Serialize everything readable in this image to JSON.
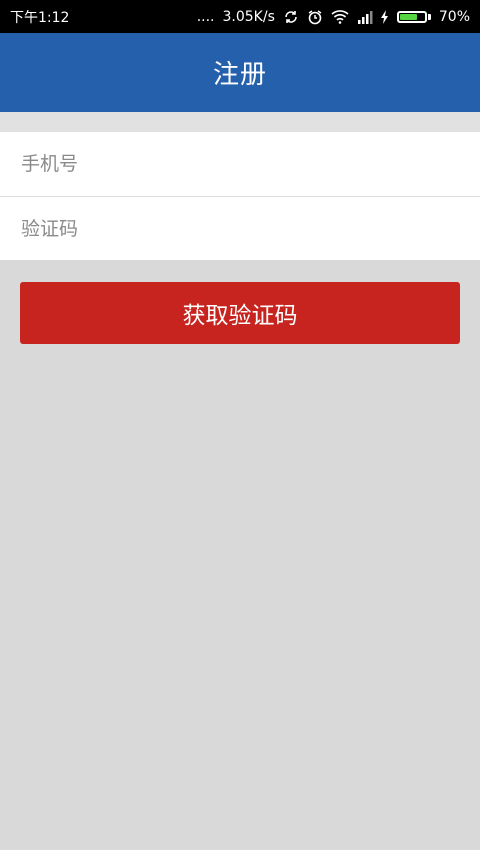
{
  "status_bar": {
    "time": "下午1:12",
    "signal_dots": "....",
    "speed": "3.05K/s",
    "battery_percent": "70%",
    "battery_level": 0.7,
    "battery_color": "#56d642"
  },
  "header": {
    "title": "注册",
    "background": "#2560ad"
  },
  "form": {
    "phone": {
      "value": "",
      "placeholder": "手机号"
    },
    "code": {
      "value": "",
      "placeholder": "验证码"
    }
  },
  "actions": {
    "get_code_label": "获取验证码",
    "button_color": "#c7241f"
  }
}
